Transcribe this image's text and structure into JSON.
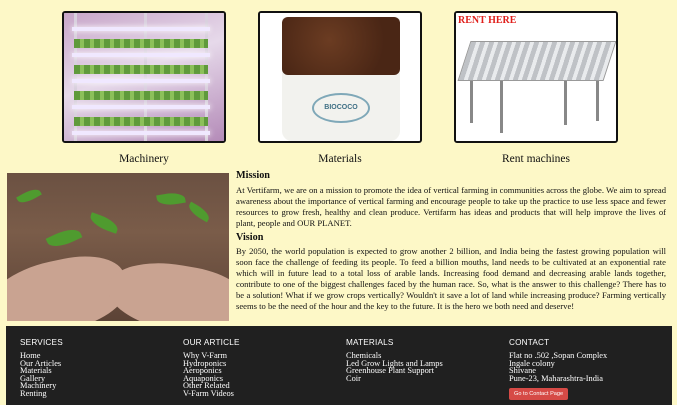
{
  "products": [
    {
      "caption": "Machinery"
    },
    {
      "caption": "Materials"
    },
    {
      "caption": "Rent machines",
      "image_text": "RENT HERE"
    }
  ],
  "materials_logo": "BIOCOCO",
  "mission": {
    "heading": "Mission",
    "text": "At Vertifarm, we are on a mission to promote the idea of vertical farming in communities across the globe. We aim to spread awareness about the importance of vertical farming and encourage people to take up the practice to use less space and fewer resources to grow fresh, healthy and clean produce. Vertifarm has ideas and products that will help improve the lives of plant, people and OUR PLANET."
  },
  "vision": {
    "heading": "Vision",
    "text": "By 2050, the world population is expected to grow another 2 billion, and India being the fastest growing population will soon face the challenge of feeding its people. To feed a billion mouths, land needs to be cultivated at an exponential rate which will in future lead to a total loss of arable lands. Increasing food demand and decreasing arable lands together, contribute to one of the biggest challenges faced by the human race. So, what is the answer to this challenge? There has to be a solution! What if we grow crops vertically? Wouldn't it save a lot of land while increasing produce? Farming vertically seems to be the need of the hour and the key to the future. It is the hero we both need and deserve!"
  },
  "footer": {
    "services": {
      "heading": "SERVICES",
      "items": [
        "Home",
        "Our Articles",
        "Materials",
        "Gallery",
        "Machinery",
        "Renting"
      ]
    },
    "articles": {
      "heading": "OUR ARTICLE",
      "items": [
        "Why V-Farm",
        "Hydroponics",
        "Aeroponics",
        "Aquaponics",
        "Other Related",
        "V-Farm Videos"
      ]
    },
    "materials": {
      "heading": "MATERIALS",
      "items": [
        "Chemicals",
        "Led Grow Lights and Lamps",
        "Greenhouse Plant Support",
        "Coir"
      ]
    },
    "contact": {
      "heading": "CONTACT",
      "lines": [
        "Flat no .502 ,Sopan Complex",
        "Ingale colony",
        "Shivane",
        "Pune-23, Maharashtra-India"
      ],
      "button": "Go to Contact Page"
    }
  },
  "colors": {
    "page_background": "#fdf8c7",
    "footer_background": "#202020",
    "button": "#d64a46",
    "rent_tag": "#e0201c"
  }
}
